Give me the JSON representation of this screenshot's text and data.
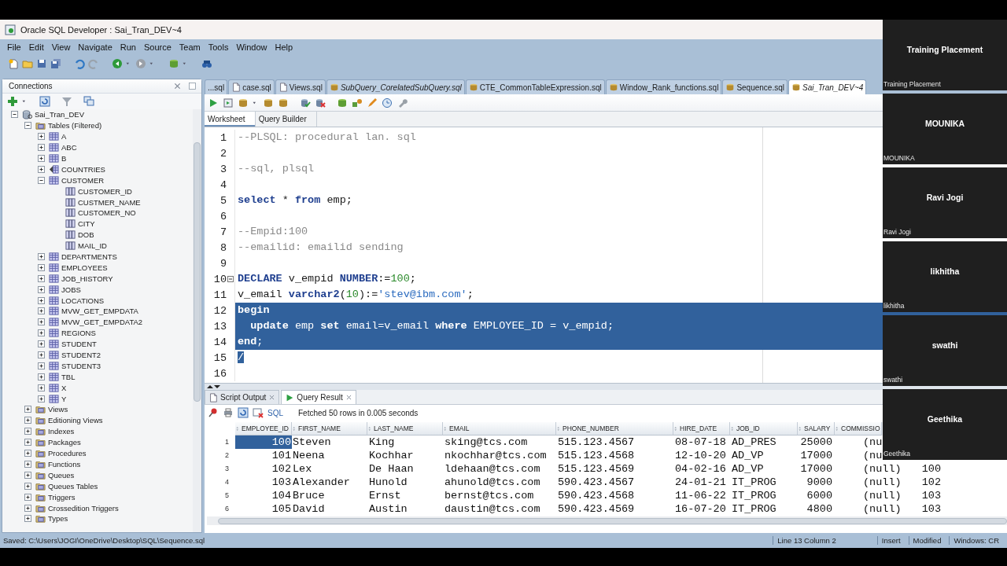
{
  "window": {
    "title": "Oracle SQL Developer : Sai_Tran_DEV~4"
  },
  "menu": [
    "File",
    "Edit",
    "View",
    "Navigate",
    "Run",
    "Source",
    "Team",
    "Tools",
    "Window",
    "Help"
  ],
  "connections": {
    "title": "Connections",
    "tree": [
      {
        "label": "Sai_Tran_DEV",
        "kind": "connection",
        "expanded": true,
        "children": [
          {
            "label": "Tables (Filtered)",
            "kind": "folder",
            "expanded": true,
            "children": [
              {
                "label": "A",
                "kind": "table",
                "expanded": false
              },
              {
                "label": "ABC",
                "kind": "table",
                "expanded": false
              },
              {
                "label": "B",
                "kind": "table",
                "expanded": false
              },
              {
                "label": "COUNTRIES",
                "kind": "iot",
                "expanded": false
              },
              {
                "label": "CUSTOMER",
                "kind": "table",
                "expanded": true,
                "children": [
                  {
                    "label": "CUSTOMER_ID",
                    "kind": "column"
                  },
                  {
                    "label": "CUSTMER_NAME",
                    "kind": "column"
                  },
                  {
                    "label": "CUSTOMER_NO",
                    "kind": "column"
                  },
                  {
                    "label": "CITY",
                    "kind": "column"
                  },
                  {
                    "label": "DOB",
                    "kind": "column"
                  },
                  {
                    "label": "MAIL_ID",
                    "kind": "column"
                  }
                ]
              },
              {
                "label": "DEPARTMENTS",
                "kind": "table",
                "expanded": false
              },
              {
                "label": "EMPLOYEES",
                "kind": "table",
                "expanded": false
              },
              {
                "label": "JOB_HISTORY",
                "kind": "table",
                "expanded": false
              },
              {
                "label": "JOBS",
                "kind": "table",
                "expanded": false
              },
              {
                "label": "LOCATIONS",
                "kind": "table",
                "expanded": false
              },
              {
                "label": "MVW_GET_EMPDATA",
                "kind": "table",
                "expanded": false
              },
              {
                "label": "MVW_GET_EMPDATA2",
                "kind": "table",
                "expanded": false
              },
              {
                "label": "REGIONS",
                "kind": "table",
                "expanded": false
              },
              {
                "label": "STUDENT",
                "kind": "table",
                "expanded": false
              },
              {
                "label": "STUDENT2",
                "kind": "table",
                "expanded": false
              },
              {
                "label": "STUDENT3",
                "kind": "table",
                "expanded": false
              },
              {
                "label": "TBL",
                "kind": "table",
                "expanded": false
              },
              {
                "label": "X",
                "kind": "table",
                "expanded": false
              },
              {
                "label": "Y",
                "kind": "table",
                "expanded": false
              }
            ]
          },
          {
            "label": "Views",
            "kind": "folder",
            "expanded": false
          },
          {
            "label": "Editioning Views",
            "kind": "folder",
            "expanded": false
          },
          {
            "label": "Indexes",
            "kind": "folder",
            "expanded": false
          },
          {
            "label": "Packages",
            "kind": "folder",
            "expanded": false
          },
          {
            "label": "Procedures",
            "kind": "folder",
            "expanded": false
          },
          {
            "label": "Functions",
            "kind": "folder",
            "expanded": false
          },
          {
            "label": "Queues",
            "kind": "folder",
            "expanded": false
          },
          {
            "label": "Queues Tables",
            "kind": "folder",
            "expanded": false
          },
          {
            "label": "Triggers",
            "kind": "folder",
            "expanded": false
          },
          {
            "label": "Crossedition Triggers",
            "kind": "folder",
            "expanded": false
          },
          {
            "label": "Types",
            "kind": "folder",
            "expanded": false
          }
        ]
      }
    ]
  },
  "editor_tabs": [
    {
      "label": "...sql",
      "kind": "clipped",
      "selected": false,
      "modified": false
    },
    {
      "label": "case.sql",
      "kind": "file",
      "selected": false,
      "modified": false
    },
    {
      "label": "Views.sql",
      "kind": "file",
      "selected": false,
      "modified": false
    },
    {
      "label": "SubQuery_CorelatedSubQuery.sql",
      "kind": "worksheet",
      "selected": false,
      "modified": true
    },
    {
      "label": "CTE_CommonTableExpression.sql",
      "kind": "worksheet",
      "selected": false,
      "modified": false
    },
    {
      "label": "Window_Rank_functions.sql",
      "kind": "worksheet",
      "selected": false,
      "modified": false
    },
    {
      "label": "Sequence.sql",
      "kind": "worksheet",
      "selected": false,
      "modified": false
    },
    {
      "label": "Sai_Tran_DEV~4",
      "kind": "worksheet",
      "selected": true,
      "modified": true
    }
  ],
  "editor_subtabs": [
    {
      "label": "Worksheet",
      "selected": true
    },
    {
      "label": "Query Builder",
      "selected": false
    }
  ],
  "code_lines": [
    {
      "number": "1",
      "fold": false,
      "selected": false,
      "tokens": [
        {
          "kind": "comment",
          "text": "--PLSQL: procedural lan. sql"
        }
      ]
    },
    {
      "number": "2",
      "fold": false,
      "selected": false
    },
    {
      "number": "3",
      "fold": false,
      "selected": false,
      "tokens": [
        {
          "kind": "comment",
          "text": "--sql, plsql"
        }
      ]
    },
    {
      "number": "4",
      "fold": false,
      "selected": false
    },
    {
      "number": "5",
      "fold": false,
      "selected": false,
      "tokens": [
        {
          "kind": "keyword",
          "text": "select"
        },
        {
          "kind": "plain",
          "text": " * "
        },
        {
          "kind": "keyword",
          "text": "from"
        },
        {
          "kind": "plain",
          "text": " emp;"
        }
      ]
    },
    {
      "number": "6",
      "fold": false,
      "selected": false
    },
    {
      "number": "7",
      "fold": false,
      "selected": false,
      "tokens": [
        {
          "kind": "comment",
          "text": "--Empid:100"
        }
      ]
    },
    {
      "number": "8",
      "fold": false,
      "selected": false,
      "tokens": [
        {
          "kind": "comment",
          "text": "--emailid: emailid sending"
        }
      ]
    },
    {
      "number": "9",
      "fold": false,
      "selected": false
    },
    {
      "number": "10",
      "fold": true,
      "selected": false,
      "tokens": [
        {
          "kind": "keyword",
          "text": "DECLARE"
        },
        {
          "kind": "plain",
          "text": " v_empid "
        },
        {
          "kind": "keyword",
          "text": "NUMBER"
        },
        {
          "kind": "plain",
          "text": ":="
        },
        {
          "kind": "number",
          "text": "100"
        },
        {
          "kind": "plain",
          "text": ";"
        }
      ]
    },
    {
      "number": "11",
      "fold": false,
      "selected": false,
      "tokens": [
        {
          "kind": "plain",
          "text": "v_email "
        },
        {
          "kind": "keyword",
          "text": "varchar2"
        },
        {
          "kind": "plain",
          "text": "("
        },
        {
          "kind": "number",
          "text": "10"
        },
        {
          "kind": "plain",
          "text": "):="
        },
        {
          "kind": "string",
          "text": "'stev@ibm.com'"
        },
        {
          "kind": "plain",
          "text": ";"
        }
      ]
    },
    {
      "number": "12",
      "fold": false,
      "selected": true,
      "tokens": [
        {
          "kind": "keyword",
          "text": "begin"
        }
      ]
    },
    {
      "number": "13",
      "fold": false,
      "selected": true,
      "tokens": [
        {
          "kind": "keyword",
          "text": "  update"
        },
        {
          "kind": "plain",
          "text": " emp "
        },
        {
          "kind": "keyword",
          "text": "set"
        },
        {
          "kind": "plain",
          "text": " email=v_email "
        },
        {
          "kind": "keyword",
          "text": "where"
        },
        {
          "kind": "plain",
          "text": " EMPLOYEE_ID = v_empid;"
        }
      ]
    },
    {
      "number": "14",
      "fold": false,
      "selected": true,
      "tokens": [
        {
          "kind": "keyword",
          "text": "end"
        },
        {
          "kind": "plain",
          "text": ";"
        }
      ]
    },
    {
      "number": "15",
      "fold": false,
      "selected": false,
      "tokens": [
        {
          "kind": "selection",
          "text": "/"
        }
      ]
    },
    {
      "number": "16",
      "fold": false,
      "selected": false
    }
  ],
  "results": {
    "tabs": [
      {
        "label": "Script Output",
        "kind": "script",
        "selected": false
      },
      {
        "label": "Query Result",
        "kind": "query",
        "selected": true
      }
    ],
    "sql_label": "SQL",
    "message": "Fetched 50 rows in 0.005 seconds",
    "columns": [
      "EMPLOYEE_ID",
      "FIRST_NAME",
      "LAST_NAME",
      "EMAIL",
      "PHONE_NUMBER",
      "HIRE_DATE",
      "JOB_ID",
      "SALARY",
      "COMMISSIO"
    ],
    "rows": [
      {
        "number": "1",
        "cell_selected": true,
        "cells": [
          "100",
          "Steven",
          "King",
          "sking@tcs.com",
          "515.123.4567",
          "08-07-18",
          "AD_PRES",
          "25000",
          "(nu"
        ]
      },
      {
        "number": "2",
        "cell_selected": false,
        "cells": [
          "101",
          "Neena",
          "Kochhar",
          "nkochhar@tcs.com",
          "515.123.4568",
          "12-10-20",
          "AD_VP",
          "17000",
          "(nu"
        ]
      },
      {
        "number": "3",
        "cell_selected": false,
        "cells": [
          "102",
          "Lex",
          "De Haan",
          "ldehaan@tcs.com",
          "515.123.4569",
          "04-02-16",
          "AD_VP",
          "17000",
          "(null)",
          "100"
        ]
      },
      {
        "number": "4",
        "cell_selected": false,
        "cells": [
          "103",
          "Alexander",
          "Hunold",
          "ahunold@tcs.com",
          "590.423.4567",
          "24-01-21",
          "IT_PROG",
          "9000",
          "(null)",
          "102"
        ]
      },
      {
        "number": "5",
        "cell_selected": false,
        "cells": [
          "104",
          "Bruce",
          "Ernst",
          "bernst@tcs.com",
          "590.423.4568",
          "11-06-22",
          "IT_PROG",
          "6000",
          "(null)",
          "103"
        ]
      },
      {
        "number": "6",
        "cell_selected": false,
        "cells": [
          "105",
          "David",
          "Austin",
          "daustin@tcs.com",
          "590.423.4569",
          "16-07-20",
          "IT_PROG",
          "4800",
          "(null)",
          "103"
        ]
      }
    ]
  },
  "status_bar": {
    "message": "Saved: C:\\Users\\JOGI\\OneDrive\\Desktop\\SQL\\Sequence.sql",
    "position": "Line 13 Column 2",
    "mode": "Insert",
    "state": "Modified",
    "line_endings": "Windows: CR"
  },
  "participants": [
    {
      "name": "Training Placement",
      "caption": "Training Placement"
    },
    {
      "name": "MOUNIKA",
      "caption": "MOUNIKA"
    },
    {
      "name": "Ravi Jogi",
      "caption": "Ravi Jogi"
    },
    {
      "name": "likhitha",
      "caption": "likhitha"
    },
    {
      "name": "swathi",
      "caption": "swathi"
    },
    {
      "name": "Geethika",
      "caption": "Geethika"
    }
  ]
}
